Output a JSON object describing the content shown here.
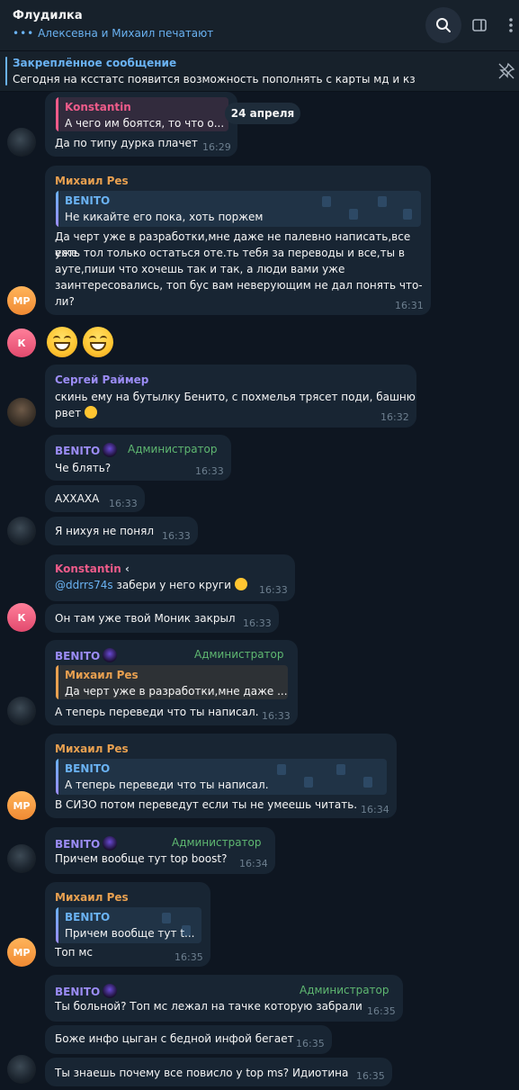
{
  "header": {
    "title": "Флудилка",
    "typing": "Алексевна и Михаил печатают"
  },
  "pinned": {
    "title": "Закреплённое сообщение",
    "text": "Сегодня на кcстатс появится возможность пополнять с карты мд и кз"
  },
  "date": "24 апреля",
  "admin_badge": "Администратор",
  "colors": {
    "bg": "#0e1621",
    "bubble": "#182533",
    "accent": "#6ab2f2",
    "orange": "#e8a050",
    "purple": "#9b8cf5",
    "pink": "#ee5b8a",
    "admin": "#5fb871"
  },
  "messages": [
    {
      "id": "m1",
      "reply_name": "Konstantin",
      "reply_text": "А чего им боятся, то что о...",
      "text": "Да по типу дурка плачет",
      "time": "16:29"
    },
    {
      "id": "m2",
      "sender": "Михаил Pes",
      "reply_name": "BENITO",
      "reply_text": "Не кикайте его пока, хоть поржем",
      "lines": [
        "Да черт уже в разработки,мне даже не палевно написать,все уже",
        "есть тол только остаться оте.ть тебя за переводы и все,ты в",
        "ауте,пиши что хочешь так и так, а люди вами уже",
        "заинтересовались, топ бус вам неверующим не дал понять что-",
        "ли?"
      ],
      "time": "16:31"
    },
    {
      "id": "m3",
      "sender": "Сергей Раймер",
      "lines": [
        "скинь ему на бутылку Бенито, с похмелья трясет поди, башню",
        "рвет"
      ],
      "time": "16:32"
    },
    {
      "id": "m4",
      "sender": "BENITO",
      "text": "Че блять?",
      "time": "16:33"
    },
    {
      "id": "m5",
      "text": "АХХАХА",
      "time": "16:33"
    },
    {
      "id": "m6",
      "text": "Я нихуя не понял",
      "time": "16:33"
    },
    {
      "id": "m7",
      "sender": "Konstantin",
      "mention": "@ddrrs74s",
      "text": " забери у него круги",
      "time": "16:33"
    },
    {
      "id": "m8",
      "text": "Он там уже твой Моник закрыл",
      "time": "16:33"
    },
    {
      "id": "m9",
      "sender": "BENITO",
      "reply_name": "Михаил Pes",
      "reply_text": "Да черт уже в разработки,мне даже ...",
      "text": "А теперь переведи что ты написал.",
      "time": "16:33"
    },
    {
      "id": "m10",
      "sender": "Михаил Pes",
      "reply_name": "BENITO",
      "reply_text": "А теперь переведи что ты написал.",
      "text": "В СИЗО потом переведут если ты не умеешь читать.",
      "time": "16:34"
    },
    {
      "id": "m11",
      "sender": "BENITO",
      "text": "Причем вообще тут top boost?",
      "time": "16:34"
    },
    {
      "id": "m12",
      "sender": "Михаил Pes",
      "reply_name": "BENITO",
      "reply_text": "Причем вообще тут t...",
      "text": "Топ мс",
      "time": "16:35"
    },
    {
      "id": "m13",
      "sender": "BENITO",
      "text": "Ты больной? Топ мс лежал на тачке которую забрали",
      "time": "16:35"
    },
    {
      "id": "m14",
      "text": "Боже инфо цыган с бедной инфой бегает",
      "time": "16:35"
    },
    {
      "id": "m15",
      "text": "Ты знаешь почему все повисло у top ms? Идиотина",
      "time": "16:35"
    }
  ],
  "avatars": {
    "mp": "МР",
    "k": "К"
  }
}
